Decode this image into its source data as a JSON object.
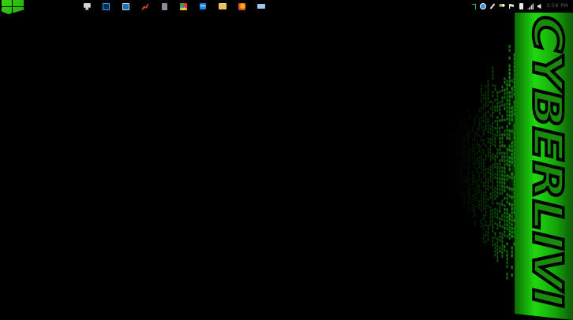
{
  "desktop": {
    "wallpaper": {
      "brand_text": "CYBERLIVI",
      "accent_color": "#1fd40f",
      "background_color": "#000000"
    }
  },
  "taskbar": {
    "start_icon": "windows-logo-icon",
    "pinned_apps": [
      {
        "icon": "computer-icon"
      },
      {
        "icon": "photoshop-icon"
      },
      {
        "icon": "image-viewer-icon"
      },
      {
        "icon": "red-tool-icon"
      },
      {
        "icon": "notepad-icon"
      },
      {
        "icon": "chrome-icon"
      },
      {
        "icon": "internet-explorer-icon"
      },
      {
        "icon": "file-explorer-icon"
      },
      {
        "icon": "firefox-icon"
      },
      {
        "icon": "keyboard-icon"
      }
    ],
    "tray_icons": [
      "green-corner-icon",
      "blue-circle-icon",
      "pen-icon",
      "people-icon",
      "flag-icon",
      "phone-icon",
      "signal-icon",
      "speaker-icon"
    ],
    "clock_text": "3:56 PM"
  }
}
